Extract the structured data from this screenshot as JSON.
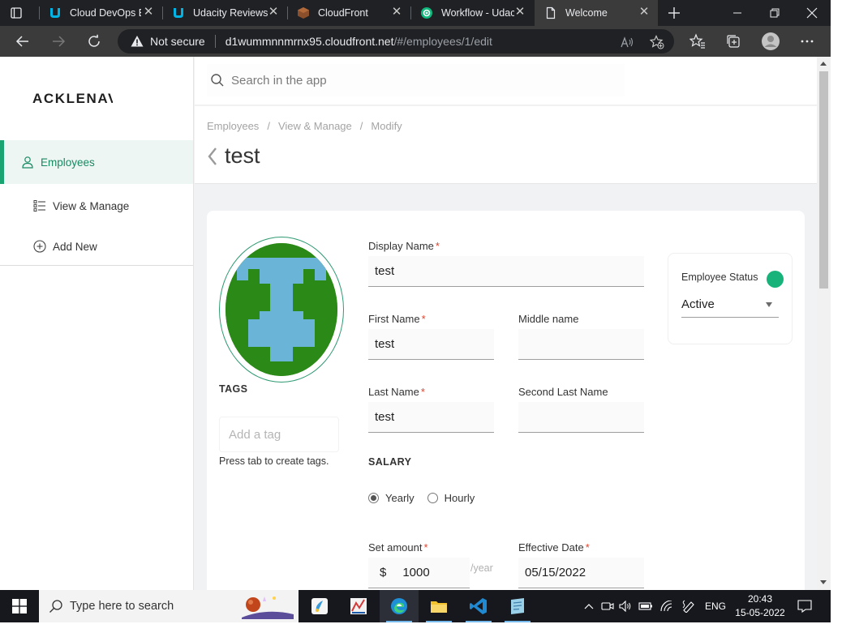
{
  "browser": {
    "tabs": [
      {
        "title": "Cloud DevOps E",
        "icon": "udacity-icon",
        "active": false
      },
      {
        "title": "Udacity Reviews",
        "icon": "udacity-icon",
        "active": false
      },
      {
        "title": "CloudFront",
        "icon": "cloudfront-icon",
        "active": false
      },
      {
        "title": "Workflow - Udac",
        "icon": "circleci-icon",
        "active": false
      },
      {
        "title": "Welcome",
        "icon": "page-icon",
        "active": true
      }
    ],
    "not_secure_label": "Not secure",
    "url_host": "d1wummnnmrnx95.cloudfront.net",
    "url_path": "/#/employees/1/edit"
  },
  "app": {
    "logo": "ACKLENAVENUE",
    "search_placeholder": "Search in the app",
    "nav": [
      {
        "label": "Employees",
        "icon": "person-icon",
        "active": true
      },
      {
        "label": "View & Manage",
        "icon": "list-icon",
        "active": false
      },
      {
        "label": "Add New",
        "icon": "plus-circle-icon",
        "active": false
      }
    ],
    "breadcrumb": [
      "Employees",
      "View & Manage",
      "Modify"
    ],
    "breadcrumb_sep": "/",
    "page_title": "test",
    "tags_label": "TAGS",
    "tag_placeholder": "Add a tag",
    "tag_hint": "Press tab to create tags.",
    "form": {
      "display_name_label": "Display Name",
      "display_name": "test",
      "first_name_label": "First Name",
      "first_name": "test",
      "middle_name_label": "Middle name",
      "middle_name": "",
      "last_name_label": "Last Name",
      "last_name": "test",
      "second_last_name_label": "Second Last Name",
      "second_last_name": "",
      "salary_label": "SALARY",
      "salary_options": [
        "Yearly",
        "Hourly"
      ],
      "salary_selected": "Yearly",
      "set_amount_label": "Set amount",
      "currency": "$",
      "amount": "1000",
      "amount_unit": "/year",
      "effective_date_label": "Effective Date",
      "effective_date": "05/15/2022",
      "required_mark": "*"
    },
    "status": {
      "label": "Employee Status",
      "value": "Active",
      "color": "#17b37a"
    }
  },
  "taskbar": {
    "search_placeholder": "Type here to search",
    "language": "ENG",
    "time": "20:43",
    "date": "15-05-2022"
  },
  "colors": {
    "accent": "#1aa471",
    "required": "#e0442e",
    "avatar_green": "#2b8a17",
    "avatar_blue": "#6ab4d8"
  }
}
